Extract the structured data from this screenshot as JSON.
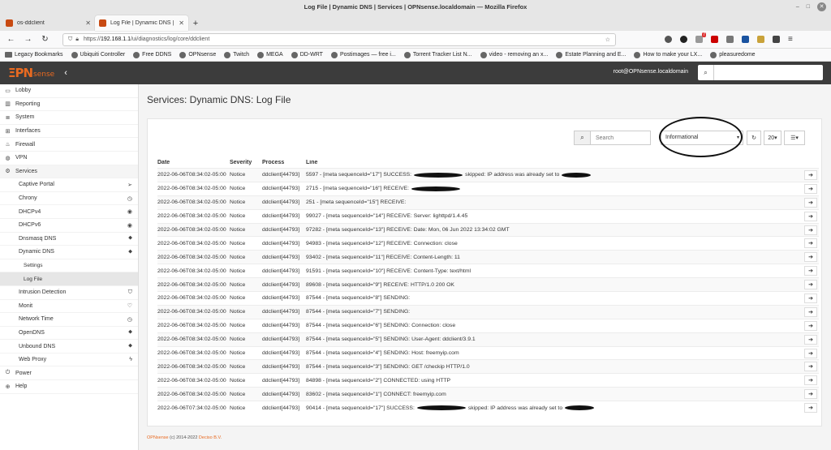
{
  "window": {
    "title": "Log File | Dynamic DNS | Services | OPNsense.localdomain — Mozilla Firefox"
  },
  "tabs": [
    {
      "label": "os-ddclient"
    },
    {
      "label": "Log File | Dynamic DNS | Se"
    }
  ],
  "navbar": {
    "url_prefix": "https://",
    "url_host": "192.168.1.1",
    "url_path": "/ui/diagnostics/log/core/ddclient",
    "ext_badge": "7"
  },
  "bookmarks": [
    "Legacy Bookmarks",
    "Ubiquiti Controller",
    "Free DDNS",
    "OPNsense",
    "Twitch",
    "MEGA",
    "DD-WRT",
    "Postimages — free i...",
    "Torrent Tracker List N...",
    "video - removing an x...",
    "Estate Planning and E...",
    "How to make your LX...",
    "pleasuredome"
  ],
  "header": {
    "logo_mark": "ΞPN",
    "logo_sense": "sense",
    "user": "root@OPNsense.localdomain"
  },
  "sidebar": {
    "items": [
      {
        "label": "Lobby",
        "icon": "laptop-icon"
      },
      {
        "label": "Reporting",
        "icon": "chart-icon"
      },
      {
        "label": "System",
        "icon": "server-icon"
      },
      {
        "label": "Interfaces",
        "icon": "sitemap-icon"
      },
      {
        "label": "Firewall",
        "icon": "fire-icon"
      },
      {
        "label": "VPN",
        "icon": "globe-icon"
      },
      {
        "label": "Services",
        "icon": "gears-icon"
      }
    ],
    "services": [
      {
        "label": "Captive Portal",
        "icon": "paper-plane-icon"
      },
      {
        "label": "Chrony",
        "icon": "clock-icon"
      },
      {
        "label": "DHCPv4",
        "icon": "bullseye-icon"
      },
      {
        "label": "DHCPv6",
        "icon": "bullseye-icon"
      },
      {
        "label": "Dnsmasq DNS",
        "icon": "tags-icon"
      },
      {
        "label": "Dynamic DNS",
        "icon": "tags-icon"
      }
    ],
    "ddns_sub": [
      {
        "label": "Settings"
      },
      {
        "label": "Log File"
      }
    ],
    "services_more": [
      {
        "label": "Intrusion Detection",
        "icon": "shield-icon"
      },
      {
        "label": "Monit",
        "icon": "heartbeat-icon"
      },
      {
        "label": "Network Time",
        "icon": "clock-icon"
      },
      {
        "label": "OpenDNS",
        "icon": "tags-icon"
      },
      {
        "label": "Unbound DNS",
        "icon": "tags-icon"
      },
      {
        "label": "Web Proxy",
        "icon": "bolt-icon"
      }
    ],
    "bottom": [
      {
        "label": "Power",
        "icon": "plug-icon"
      },
      {
        "label": "Help",
        "icon": "help-icon"
      }
    ]
  },
  "page": {
    "title": "Services: Dynamic DNS: Log File"
  },
  "toolbar": {
    "search_placeholder": "Search",
    "level": "Informational",
    "refresh_icon": "refresh-icon",
    "rows_per_page": "20",
    "columns_icon": "list-icon"
  },
  "table": {
    "headers": {
      "date": "Date",
      "severity": "Severity",
      "process": "Process",
      "line": "Line"
    },
    "rows": [
      {
        "date": "2022-06-06T08:34:02-05:00",
        "severity": "Notice",
        "process": "ddclient[44793]",
        "line": "5597 - [meta sequenceId=\"17\"] SUCCESS:",
        "tail": "skipped: IP address was already set to"
      },
      {
        "date": "2022-06-06T08:34:02-05:00",
        "severity": "Notice",
        "process": "ddclient[44793]",
        "line": "2715 - [meta sequenceId=\"16\"] RECEIVE:",
        "tail": ""
      },
      {
        "date": "2022-06-06T08:34:02-05:00",
        "severity": "Notice",
        "process": "ddclient[44793]",
        "line": "251 - [meta sequenceId=\"15\"] RECEIVE:",
        "tail": ""
      },
      {
        "date": "2022-06-06T08:34:02-05:00",
        "severity": "Notice",
        "process": "ddclient[44793]",
        "line": "99027 - [meta sequenceId=\"14\"] RECEIVE: Server: lighttpd/1.4.45",
        "tail": ""
      },
      {
        "date": "2022-06-06T08:34:02-05:00",
        "severity": "Notice",
        "process": "ddclient[44793]",
        "line": "97282 - [meta sequenceId=\"13\"] RECEIVE: Date: Mon, 06 Jun 2022 13:34:02 GMT",
        "tail": ""
      },
      {
        "date": "2022-06-06T08:34:02-05:00",
        "severity": "Notice",
        "process": "ddclient[44793]",
        "line": "94983 - [meta sequenceId=\"12\"] RECEIVE: Connection: close",
        "tail": ""
      },
      {
        "date": "2022-06-06T08:34:02-05:00",
        "severity": "Notice",
        "process": "ddclient[44793]",
        "line": "93402 - [meta sequenceId=\"11\"] RECEIVE: Content-Length: 11",
        "tail": ""
      },
      {
        "date": "2022-06-06T08:34:02-05:00",
        "severity": "Notice",
        "process": "ddclient[44793]",
        "line": "91591 - [meta sequenceId=\"10\"] RECEIVE: Content-Type: text/html",
        "tail": ""
      },
      {
        "date": "2022-06-06T08:34:02-05:00",
        "severity": "Notice",
        "process": "ddclient[44793]",
        "line": "89608 - [meta sequenceId=\"9\"] RECEIVE: HTTP/1.0 200 OK",
        "tail": ""
      },
      {
        "date": "2022-06-06T08:34:02-05:00",
        "severity": "Notice",
        "process": "ddclient[44793]",
        "line": "87544 - [meta sequenceId=\"8\"] SENDING:",
        "tail": ""
      },
      {
        "date": "2022-06-06T08:34:02-05:00",
        "severity": "Notice",
        "process": "ddclient[44793]",
        "line": "87544 - [meta sequenceId=\"7\"] SENDING:",
        "tail": ""
      },
      {
        "date": "2022-06-06T08:34:02-05:00",
        "severity": "Notice",
        "process": "ddclient[44793]",
        "line": "87544 - [meta sequenceId=\"6\"] SENDING: Connection: close",
        "tail": ""
      },
      {
        "date": "2022-06-06T08:34:02-05:00",
        "severity": "Notice",
        "process": "ddclient[44793]",
        "line": "87544 - [meta sequenceId=\"5\"] SENDING: User-Agent: ddclient/3.9.1",
        "tail": ""
      },
      {
        "date": "2022-06-06T08:34:02-05:00",
        "severity": "Notice",
        "process": "ddclient[44793]",
        "line": "87544 - [meta sequenceId=\"4\"] SENDING: Host: freemyip.com",
        "tail": ""
      },
      {
        "date": "2022-06-06T08:34:02-05:00",
        "severity": "Notice",
        "process": "ddclient[44793]",
        "line": "87544 - [meta sequenceId=\"3\"] SENDING: GET /checkip HTTP/1.0",
        "tail": ""
      },
      {
        "date": "2022-06-06T08:34:02-05:00",
        "severity": "Notice",
        "process": "ddclient[44793]",
        "line": "84898 - [meta sequenceId=\"2\"] CONNECTED: using HTTP",
        "tail": ""
      },
      {
        "date": "2022-06-06T08:34:02-05:00",
        "severity": "Notice",
        "process": "ddclient[44793]",
        "line": "83602 - [meta sequenceId=\"1\"] CONNECT: freemyip.com",
        "tail": ""
      },
      {
        "date": "2022-06-06T07:34:02-05:00",
        "severity": "Notice",
        "process": "ddclient[44793]",
        "line": "90414 - [meta sequenceId=\"17\"] SUCCESS:",
        "tail": "skipped: IP address was already set to"
      }
    ]
  },
  "footer": {
    "brand": "OPNsense",
    "copyright": "(c) 2014-2022",
    "company": "Deciso B.V."
  },
  "colors": {
    "brand": "#e86a21",
    "header_bg": "#3c3c3c"
  }
}
